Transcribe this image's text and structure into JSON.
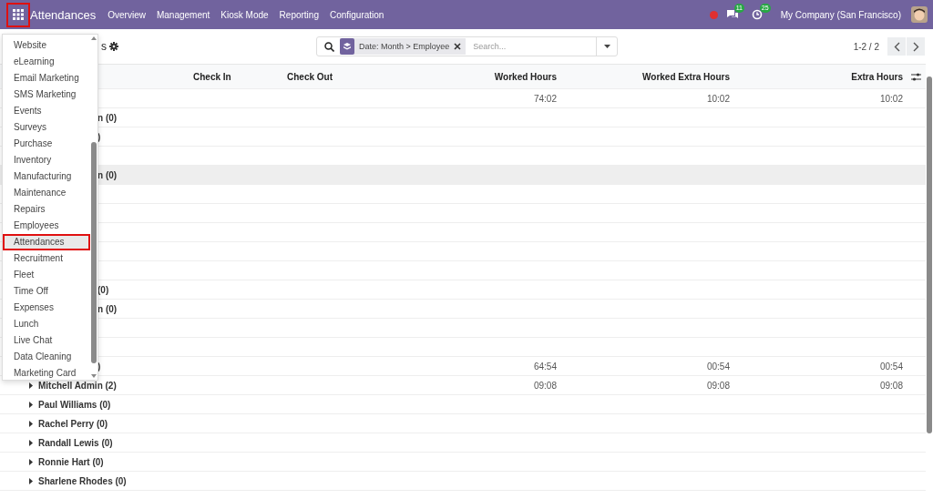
{
  "navbar": {
    "app_title": "Attendances",
    "menu": [
      "Overview",
      "Management",
      "Kiosk Mode",
      "Reporting",
      "Configuration"
    ],
    "messages_count": "11",
    "activities_count": "25",
    "company": "My Company (San Francisco)"
  },
  "app_menu": {
    "items": [
      {
        "label": "Website",
        "selected": false
      },
      {
        "label": "eLearning",
        "selected": false
      },
      {
        "label": "Email Marketing",
        "selected": false
      },
      {
        "label": "SMS Marketing",
        "selected": false
      },
      {
        "label": "Events",
        "selected": false
      },
      {
        "label": "Surveys",
        "selected": false
      },
      {
        "label": "Purchase",
        "selected": false
      },
      {
        "label": "Inventory",
        "selected": false
      },
      {
        "label": "Manufacturing",
        "selected": false
      },
      {
        "label": "Maintenance",
        "selected": false
      },
      {
        "label": "Repairs",
        "selected": false
      },
      {
        "label": "Employees",
        "selected": false
      },
      {
        "label": "Attendances",
        "selected": true
      },
      {
        "label": "Recruitment",
        "selected": false
      },
      {
        "label": "Fleet",
        "selected": false
      },
      {
        "label": "Time Off",
        "selected": false
      },
      {
        "label": "Expenses",
        "selected": false
      },
      {
        "label": "Lunch",
        "selected": false
      },
      {
        "label": "Live Chat",
        "selected": false
      },
      {
        "label": "Data Cleaning",
        "selected": false
      },
      {
        "label": "Marketing Card",
        "selected": false
      }
    ]
  },
  "toolbar": {
    "title_fragment": "s",
    "search": {
      "facet": "Date: Month > Employee",
      "placeholder": "Search..."
    },
    "pager": "1-2 / 2"
  },
  "table": {
    "columns": [
      "Check In",
      "Check Out",
      "Worked Hours",
      "Worked Extra Hours",
      "Extra Hours"
    ],
    "rows": [
      {
        "kind": "cut",
        "highlighted": false,
        "worked": "74:02",
        "worked_extra": "10:02",
        "extra": "10:02"
      },
      {
        "kind": "cut",
        "highlighted": false,
        "label": "n (0)"
      },
      {
        "kind": "cut",
        "highlighted": false,
        "label": ")"
      },
      {
        "kind": "cut",
        "highlighted": false
      },
      {
        "kind": "cut",
        "highlighted": true,
        "label": "n (0)"
      },
      {
        "kind": "cut",
        "highlighted": false
      },
      {
        "kind": "cut",
        "highlighted": false
      },
      {
        "kind": "cut",
        "highlighted": false
      },
      {
        "kind": "cut",
        "highlighted": false
      },
      {
        "kind": "cut",
        "highlighted": false
      },
      {
        "kind": "cut",
        "highlighted": false,
        "label": "(0)"
      },
      {
        "kind": "cut",
        "highlighted": false,
        "label": "n (0)"
      },
      {
        "kind": "cut",
        "highlighted": false
      },
      {
        "kind": "cut",
        "highlighted": false
      },
      {
        "kind": "cut",
        "highlighted": false,
        "label": ")",
        "worked": "64:54",
        "worked_extra": "00:54",
        "extra": "00:54"
      },
      {
        "kind": "employee",
        "highlighted": false,
        "label": "Mitchell Admin (2)",
        "worked": "09:08",
        "worked_extra": "09:08",
        "extra": "09:08"
      },
      {
        "kind": "employee",
        "highlighted": false,
        "label": "Paul Williams (0)"
      },
      {
        "kind": "employee",
        "highlighted": false,
        "label": "Rachel Perry (0)"
      },
      {
        "kind": "employee",
        "highlighted": false,
        "label": "Randall Lewis (0)"
      },
      {
        "kind": "employee",
        "highlighted": false,
        "label": "Ronnie Hart (0)"
      },
      {
        "kind": "employee",
        "highlighted": false,
        "label": "Sharlene Rhodes (0)"
      }
    ]
  }
}
